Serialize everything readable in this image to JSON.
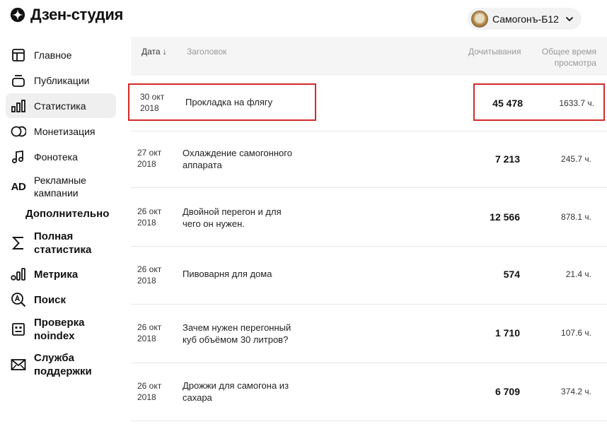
{
  "app": {
    "title": "Дзен-студия"
  },
  "channel": {
    "name": "Самогонъ-Б12"
  },
  "sidebar": {
    "items": [
      {
        "label": "Главное",
        "icon": "layout-icon"
      },
      {
        "label": "Публикации",
        "icon": "publications-icon"
      },
      {
        "label": "Статистика",
        "icon": "bar-chart-icon",
        "active": true
      },
      {
        "label": "Монетизация",
        "icon": "coins-icon"
      },
      {
        "label": "Фонотека",
        "icon": "music-note-icon"
      },
      {
        "label": "Рекламные кампании",
        "icon": "ad-icon"
      }
    ],
    "section_title": "Дополнительно",
    "extra_items": [
      {
        "label": "Полная статистика",
        "icon": "sigma-icon"
      },
      {
        "label": "Метрика",
        "icon": "metrika-icon"
      },
      {
        "label": "Поиск",
        "icon": "search-icon"
      },
      {
        "label": "Проверка noindex",
        "icon": "noindex-icon"
      },
      {
        "label": "Служба поддержки",
        "icon": "mail-icon"
      }
    ]
  },
  "table": {
    "headers": {
      "date": "Дата ↓",
      "title": "Заголовок",
      "reads": "Дочитывания",
      "time": "Общее время просмотра"
    },
    "rows": [
      {
        "date": "30 окт 2018",
        "title": "Прокладка на флягу",
        "reads": "45 478",
        "time": "1633.7 ч.",
        "highlighted": true
      },
      {
        "date": "27 окт 2018",
        "title": "Охлаждение самогонного аппарата",
        "reads": "7 213",
        "time": "245.7 ч."
      },
      {
        "date": "26 окт 2018",
        "title": "Двойной перегон и для чего он нужен.",
        "reads": "12 566",
        "time": "878.1 ч."
      },
      {
        "date": "26 окт 2018",
        "title": "Пивоварня для дома",
        "reads": "574",
        "time": "21.4 ч."
      },
      {
        "date": "26 окт 2018",
        "title": "Зачем нужен перегонный куб объёмом 30 литров?",
        "reads": "1 710",
        "time": "107.6 ч."
      },
      {
        "date": "26 окт 2018",
        "title": "Дрожжи для самогона из сахара",
        "reads": "6 709",
        "time": "374.2 ч."
      }
    ]
  },
  "colors": {
    "highlight": "#d42a2a",
    "header_bg": "#f5f5f5",
    "active_bg": "#efefef"
  }
}
